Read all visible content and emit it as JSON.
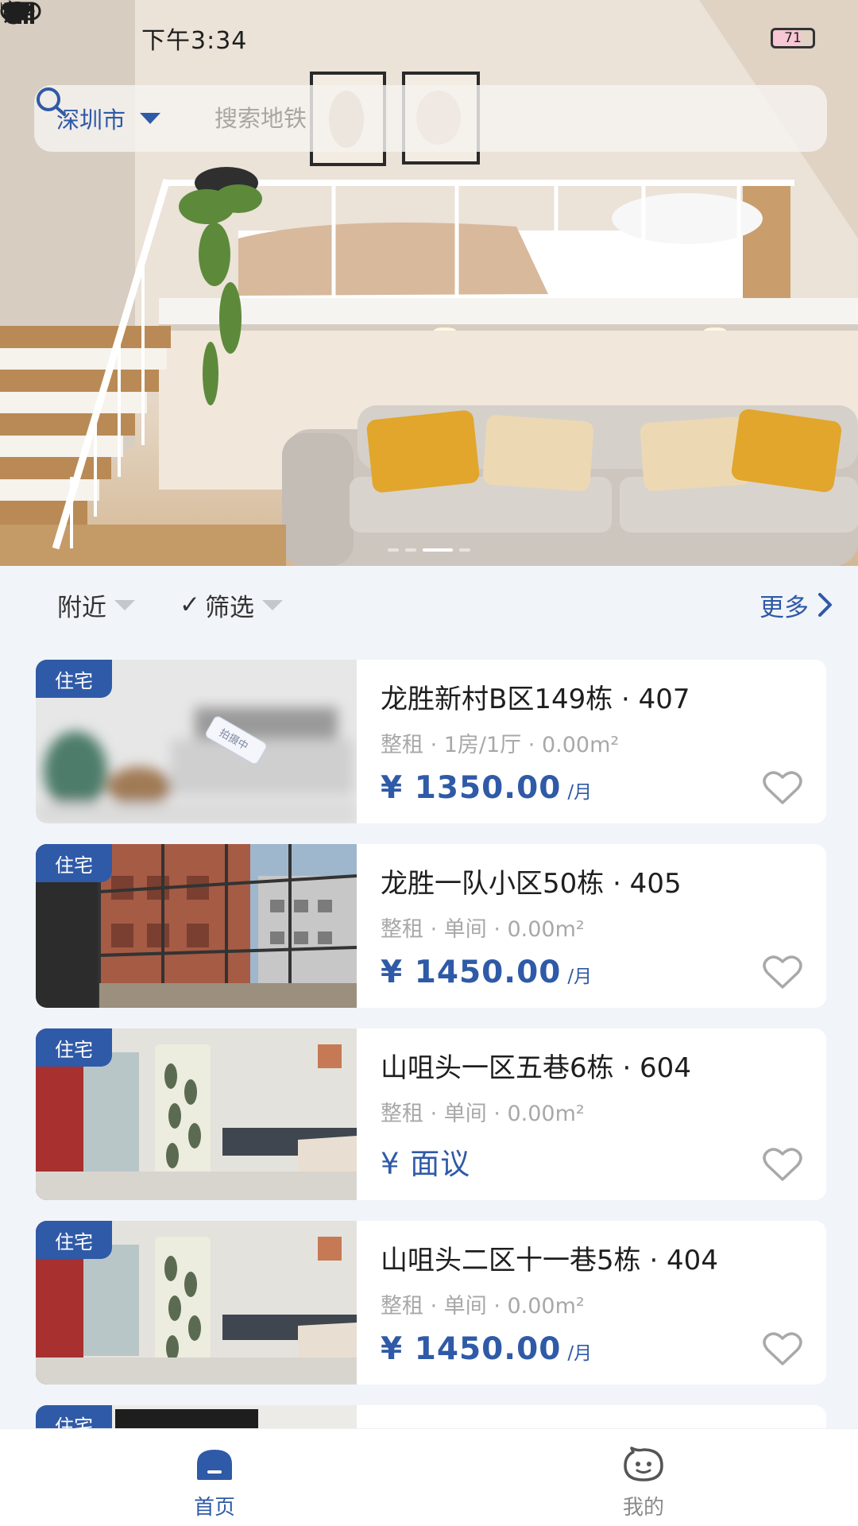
{
  "status_bar": {
    "time": "下午3:34",
    "battery": "71",
    "icons": [
      "bluetooth-icon",
      "nfc-icon",
      "mute-icon",
      "alarm-icon",
      "signal-hd-icon",
      "signal-hd-icon",
      "wifi-icon",
      "battery-icon",
      "charging-icon"
    ]
  },
  "search": {
    "city": "深圳市",
    "placeholder": "搜索地铁"
  },
  "banner": {
    "slides": 3,
    "active_slide": 2
  },
  "filters": {
    "nearby": "附近",
    "filter": "筛选",
    "more": "更多"
  },
  "listings": [
    {
      "badge": "住宅",
      "title": "龙胜新村B区149栋 · 407",
      "sub": "整租 · 1房/1厅 · 0.00m²",
      "price": "¥ 1350.00",
      "unit": "/月"
    },
    {
      "badge": "住宅",
      "title": "龙胜一队小区50栋 · 405",
      "sub": "整租 · 单间 · 0.00m²",
      "price": "¥ 1450.00",
      "unit": "/月"
    },
    {
      "badge": "住宅",
      "title": "山咀头一区五巷6栋 · 604",
      "sub": "整租 · 单间 · 0.00m²",
      "price": "¥ 面议",
      "unit": ""
    },
    {
      "badge": "住宅",
      "title": "山咀头二区十一巷5栋 · 404",
      "sub": "整租 · 单间 · 0.00m²",
      "price": "¥ 1450.00",
      "unit": "/月"
    },
    {
      "badge": "住宅"
    }
  ],
  "tabs": [
    {
      "label": "首页",
      "active": true
    },
    {
      "label": "我的",
      "active": false
    }
  ],
  "colors": {
    "accent": "#2f5aa7",
    "background": "#f1f4f9"
  }
}
